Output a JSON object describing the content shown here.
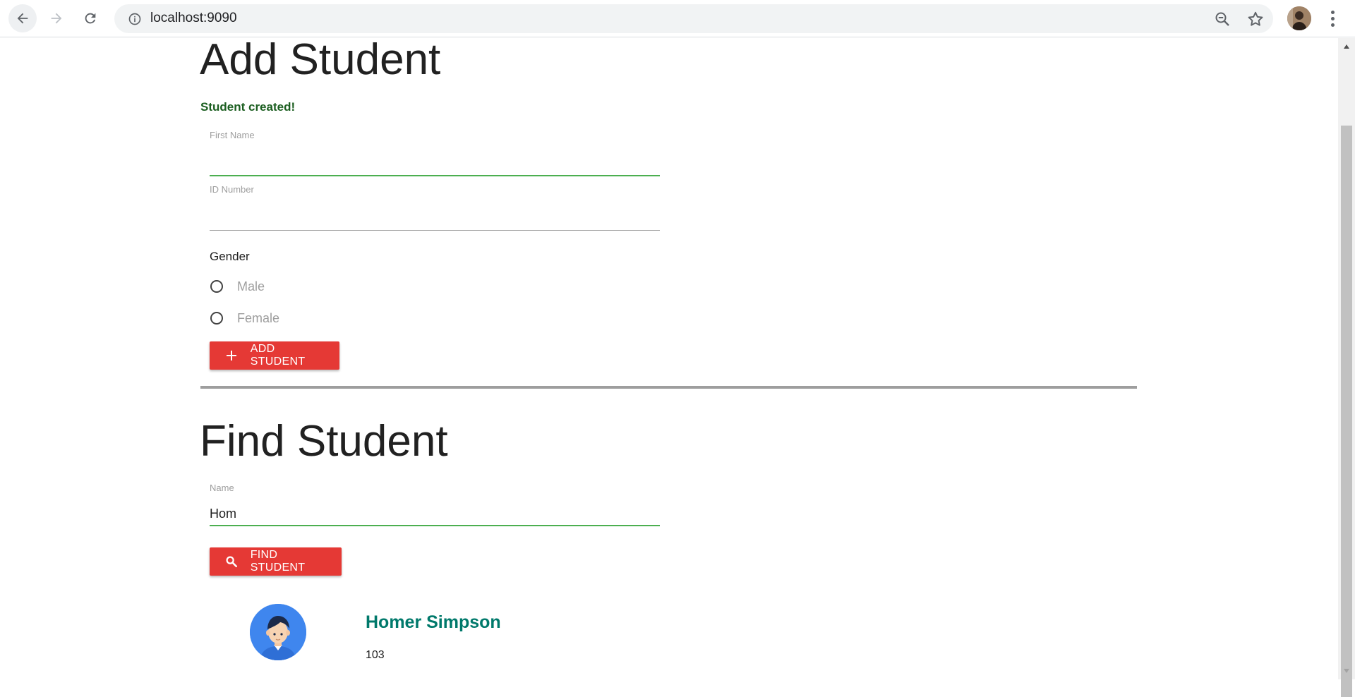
{
  "browser": {
    "url": "localhost:9090",
    "icons": {
      "back": "arrow-left-icon",
      "forward": "arrow-right-icon",
      "reload": "reload-icon",
      "info": "info-icon",
      "zoom": "zoom-out-icon",
      "bookmark": "star-icon",
      "menu": "kebab-menu-icon"
    }
  },
  "add_student": {
    "title": "Add Student",
    "success_message": "Student created!",
    "first_name": {
      "label": "First Name",
      "value": ""
    },
    "id_number": {
      "label": "ID Number",
      "value": ""
    },
    "gender": {
      "label": "Gender",
      "options": [
        "Male",
        "Female"
      ],
      "selected": null
    },
    "button_label": "ADD STUDENT",
    "button_icon": "plus-icon"
  },
  "find_student": {
    "title": "Find Student",
    "name": {
      "label": "Name",
      "value": "Hom"
    },
    "button_label": "FIND STUDENT",
    "button_icon": "search-icon"
  },
  "results": [
    {
      "name": "Homer Simpson",
      "id": "103",
      "avatar": "student-avatar"
    }
  ],
  "colors": {
    "primary_button": "#e53935",
    "focus_underline": "#4caf50",
    "success_text": "#1b5e20",
    "result_name": "#00796b",
    "avatar_bg": "#3f86ee"
  }
}
